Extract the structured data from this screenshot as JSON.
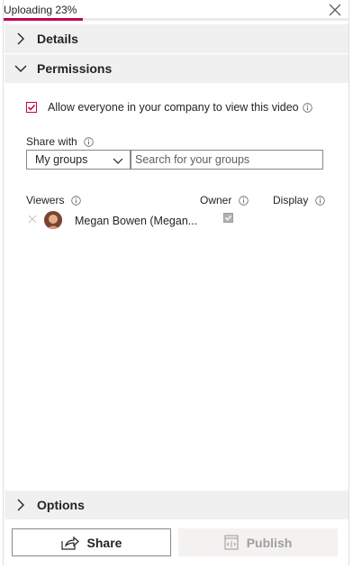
{
  "upload": {
    "status_text": "Uploading 23%",
    "progress": 0.23
  },
  "sections": {
    "details": {
      "label": "Details"
    },
    "permissions": {
      "label": "Permissions"
    },
    "options": {
      "label": "Options"
    }
  },
  "permissions": {
    "allow_everyone_label": "Allow everyone in your company to view this video",
    "allow_everyone_checked": true,
    "share_with_label": "Share with",
    "group_select_value": "My groups",
    "search_placeholder": "Search for your groups",
    "columns": {
      "viewers": "Viewers",
      "owner": "Owner",
      "display": "Display"
    },
    "viewers": [
      {
        "name": "Megan Bowen (Megan...",
        "owner": true
      }
    ]
  },
  "actions": {
    "share_label": "Share",
    "publish_label": "Publish"
  },
  "colors": {
    "accent": "#c30052",
    "header_bg": "#f0f0f0",
    "disabled_bg": "#f3f2f1"
  }
}
